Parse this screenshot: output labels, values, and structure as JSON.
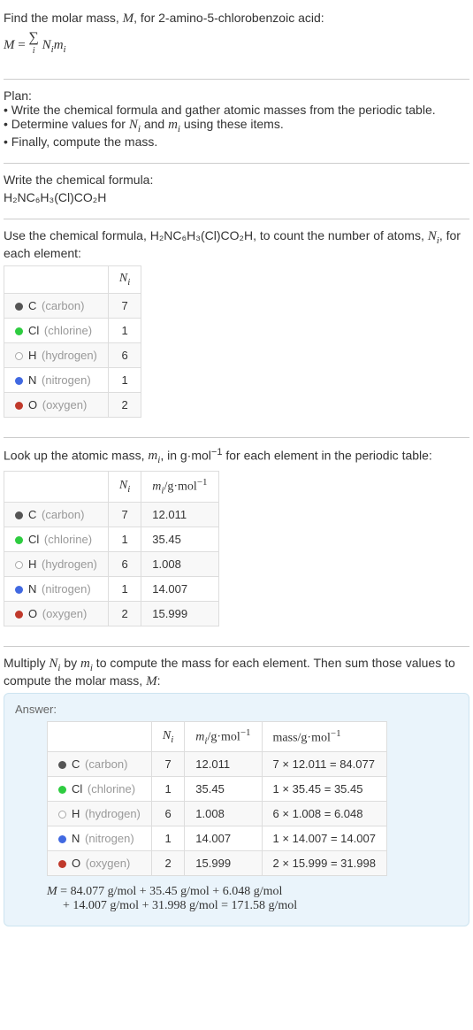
{
  "intro": {
    "line1_pre": "Find the molar mass, ",
    "line1_var": "M",
    "line1_post": ", for 2-amino-5-chlorobenzoic acid:",
    "eq_M": "M",
    "eq_eq": " = ",
    "eq_sum": "∑",
    "eq_sub": "i",
    "eq_Nm": "N",
    "eq_Nm_sub": "i",
    "eq_m": "m",
    "eq_m_sub": "i"
  },
  "plan": {
    "title": "Plan:",
    "b1_pre": "• Write the chemical formula and gather atomic masses from the periodic table.",
    "b2_pre": "• Determine values for ",
    "b2_N": "N",
    "b2_Ni": "i",
    "b2_and": " and ",
    "b2_m": "m",
    "b2_mi": "i",
    "b2_post": " using these items.",
    "b3": "• Finally, compute the mass."
  },
  "write_formula": {
    "heading": "Write the chemical formula:",
    "formula": "H₂NC₆H₃(Cl)CO₂H"
  },
  "count_atoms": {
    "pre": "Use the chemical formula, ",
    "formula": "H₂NC₆H₃(Cl)CO₂H",
    "mid": ", to count the number of atoms, ",
    "N": "N",
    "Ni": "i",
    "post": ", for each element:",
    "header_N": "N",
    "header_Ni": "i"
  },
  "lookup": {
    "pre": "Look up the atomic mass, ",
    "m": "m",
    "mi": "i",
    "mid": ", in g·mol",
    "exp": "−1",
    "post": " for each element in the periodic table:",
    "h_N": "N",
    "h_Ni": "i",
    "h_m": "m",
    "h_mi": "i",
    "h_unit": "/g·mol",
    "h_exp": "−1"
  },
  "multiply": {
    "pre": "Multiply ",
    "N": "N",
    "Ni": "i",
    "by": " by ",
    "m": "m",
    "mi": "i",
    "post": " to compute the mass for each element. Then sum those values to compute the molar mass, ",
    "M": "M",
    "colon": ":"
  },
  "answer": {
    "label": "Answer:",
    "h_N": "N",
    "h_Ni": "i",
    "h_m": "m",
    "h_mi": "i",
    "h_munit": "/g·mol",
    "h_mexp": "−1",
    "h_mass": "mass/g·mol",
    "h_massexp": "−1",
    "eq1": "M = 84.077 g/mol + 35.45 g/mol + 6.048 g/mol",
    "eq2": "+ 14.007 g/mol + 31.998 g/mol = 171.58 g/mol"
  },
  "elements": [
    {
      "sym": "C",
      "name": "(carbon)",
      "dot": "dot-c",
      "N": "7",
      "m": "12.011",
      "mass": "7 × 12.011 = 84.077"
    },
    {
      "sym": "Cl",
      "name": "(chlorine)",
      "dot": "dot-cl",
      "N": "1",
      "m": "35.45",
      "mass": "1 × 35.45 = 35.45"
    },
    {
      "sym": "H",
      "name": "(hydrogen)",
      "dot": "dot-h",
      "N": "6",
      "m": "1.008",
      "mass": "6 × 1.008 = 6.048"
    },
    {
      "sym": "N",
      "name": "(nitrogen)",
      "dot": "dot-n",
      "N": "1",
      "m": "14.007",
      "mass": "1 × 14.007 = 14.007"
    },
    {
      "sym": "O",
      "name": "(oxygen)",
      "dot": "dot-o",
      "N": "2",
      "m": "15.999",
      "mass": "2 × 15.999 = 31.998"
    }
  ]
}
